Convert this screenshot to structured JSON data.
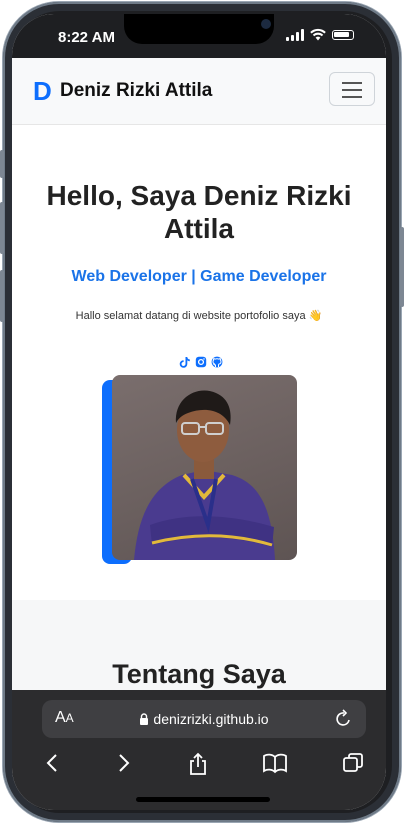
{
  "status_bar": {
    "time": "8:22 AM"
  },
  "navbar": {
    "logo_letter": "D",
    "brand": "Deniz Rizki Attila"
  },
  "hero": {
    "title": "Hello, Saya Deniz Rizki Attila",
    "subtitle": "Web Developer | Game Developer",
    "greeting": "Hallo selamat datang di website portofolio saya 👋",
    "social_icons": [
      "tiktok-icon",
      "instagram-icon",
      "github-icon"
    ]
  },
  "about": {
    "title": "Tentang Saya"
  },
  "browser": {
    "aa_large": "A",
    "aa_small": "A",
    "url": "denizrizki.github.io"
  },
  "colors": {
    "accent": "#0d6efd",
    "subtitle": "#1a73e8"
  }
}
